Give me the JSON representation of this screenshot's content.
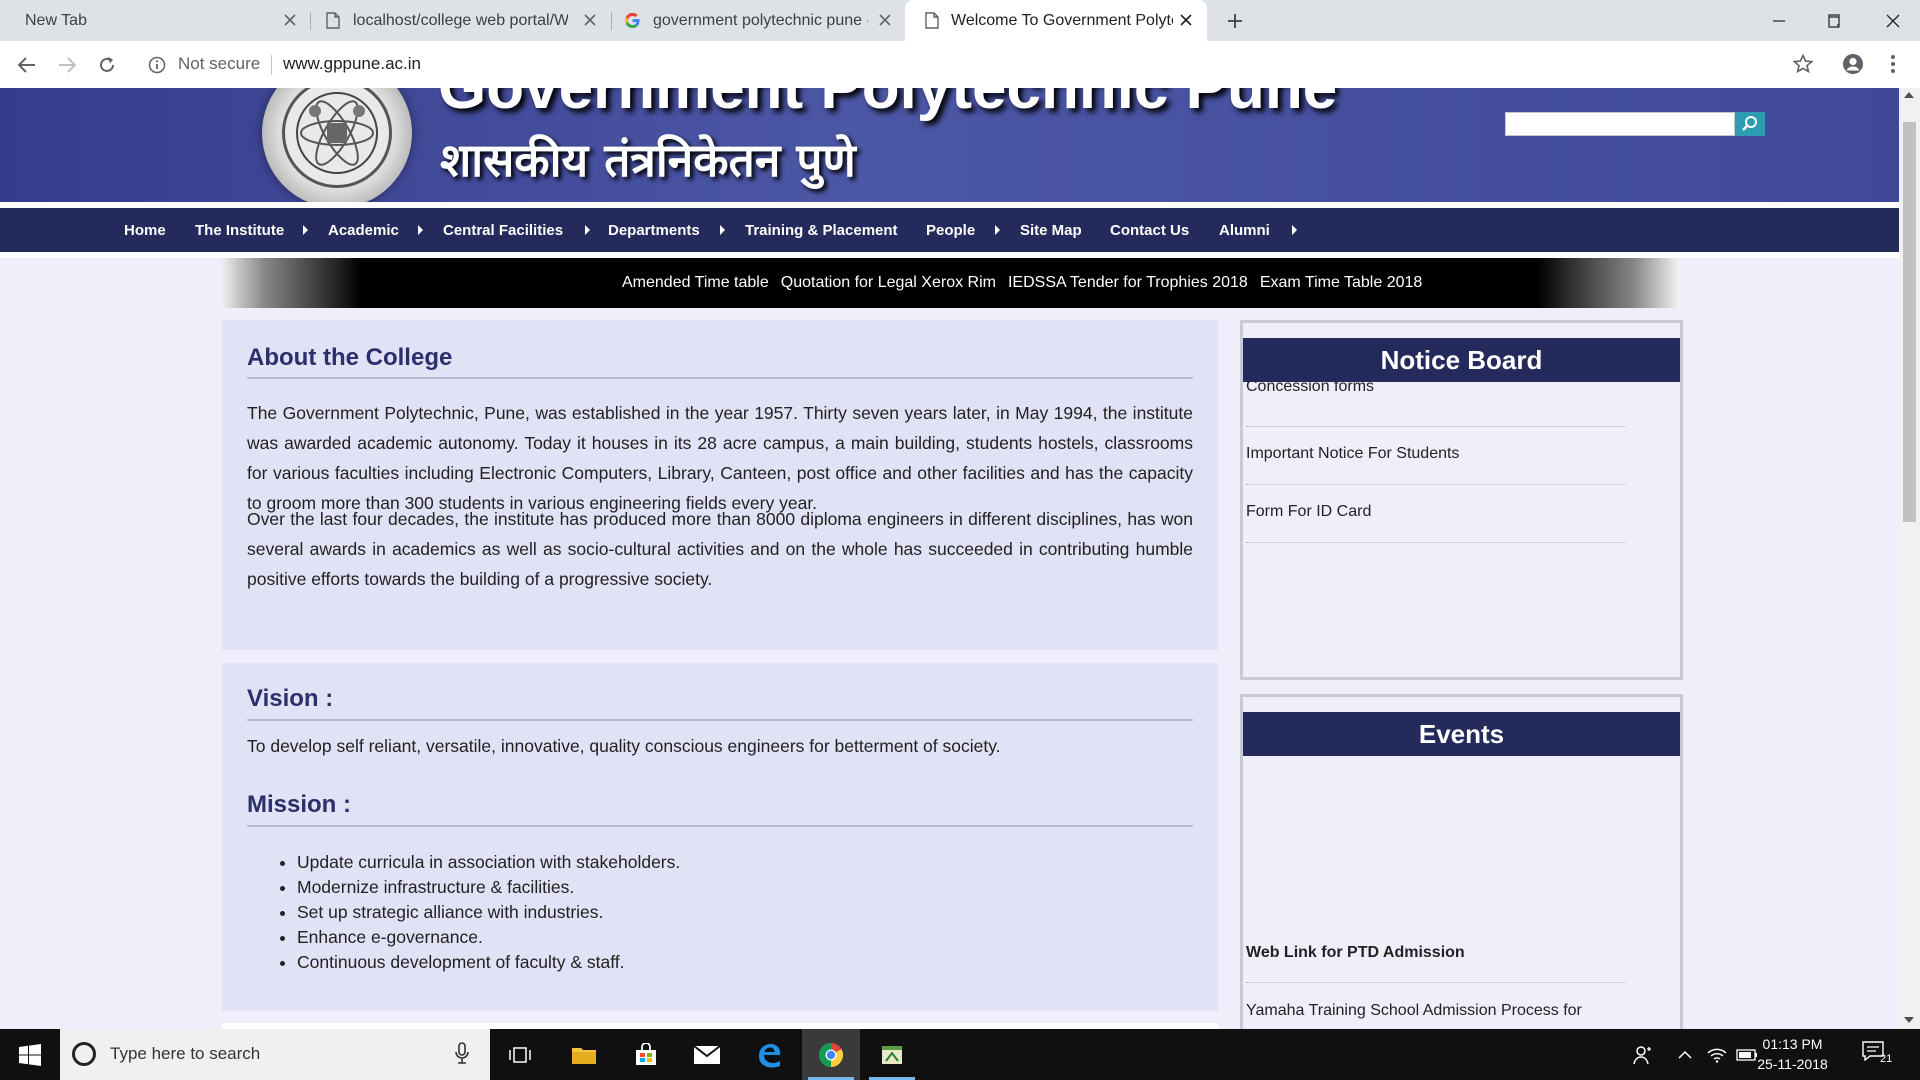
{
  "browser": {
    "tabs": [
      {
        "title": "New Tab",
        "favicon": "none",
        "active": false
      },
      {
        "title": "localhost/college web portal/WC",
        "favicon": "page-icon",
        "active": false
      },
      {
        "title": "government polytechnic pune - G",
        "favicon": "google-icon",
        "active": false
      },
      {
        "title": "Welcome To Government Polytec",
        "favicon": "page-icon",
        "active": true
      }
    ],
    "security_label": "Not secure",
    "url": "www.gppune.ac.in"
  },
  "site": {
    "title_en": "Government Polytechnic Pune",
    "title_mr": "शासकीय तंत्रनिकेतन पुणे",
    "search_placeholder": "",
    "nav": [
      {
        "label": "Home",
        "has_submenu": false
      },
      {
        "label": "The Institute",
        "has_submenu": true
      },
      {
        "label": "Academic",
        "has_submenu": true
      },
      {
        "label": "Central Facilities",
        "has_submenu": true
      },
      {
        "label": "Departments",
        "has_submenu": true
      },
      {
        "label": "Training & Placement",
        "has_submenu": false
      },
      {
        "label": "People",
        "has_submenu": true
      },
      {
        "label": "Site Map",
        "has_submenu": false
      },
      {
        "label": "Contact Us",
        "has_submenu": false
      },
      {
        "label": "Alumni",
        "has_submenu": true
      }
    ],
    "ticker": [
      "Amended Time table",
      "Quotation for Legal Xerox Rim",
      "IEDSSA Tender for Trophies 2018",
      "Exam Time Table 2018"
    ]
  },
  "about": {
    "heading": "About the College",
    "para1": "The Government Polytechnic, Pune, was established in the year 1957. Thirty seven years later, in May 1994, the institute was awarded academic autonomy. Today it houses in its 28 acre campus, a main building, students hostels, classrooms for various faculties including Electronic Computers, Library, Canteen, post office and other facilities and has the capacity to groom more than 300 students in various engineering fields every year.",
    "para2": "Over the last four decades, the institute has produced more than 8000 diploma engineers in different disciplines, has won several awards in academics as well as socio-cultural activities and on the whole has succeeded in contributing humble positive efforts towards the building of a progressive society."
  },
  "vision": {
    "heading": "Vision :",
    "text": "To develop self reliant, versatile, innovative, quality conscious engineers for betterment of society."
  },
  "mission": {
    "heading": "Mission :",
    "items": [
      "Update curricula in association with stakeholders.",
      "Modernize infrastructure & facilities.",
      "Set up strategic alliance with industries.",
      "Enhance e-governance.",
      "Continuous development of faculty & staff."
    ]
  },
  "notice_board": {
    "heading": "Notice Board",
    "items": [
      "Concession forms",
      "Important Notice For Students",
      "Form For ID Card"
    ]
  },
  "events": {
    "heading": "Events",
    "items": [
      "Web Link for PTD Admission",
      "Yamaha Training School Admission Process for"
    ]
  },
  "taskbar": {
    "search_placeholder": "Type here to search",
    "time": "01:13 PM",
    "date": "25-11-2018",
    "notification_count": "21"
  }
}
